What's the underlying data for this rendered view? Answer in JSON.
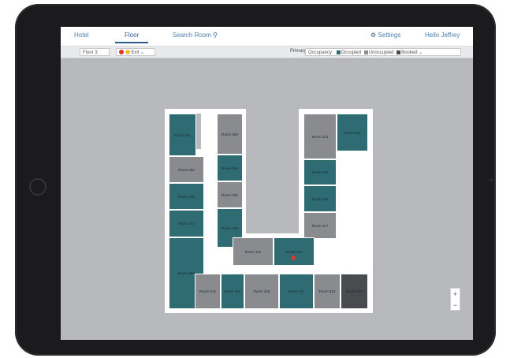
{
  "nav": {
    "tabs": [
      {
        "label": "Hotel"
      },
      {
        "label": "Floor"
      },
      {
        "label": "Search Room"
      }
    ],
    "settings_label": "Settings",
    "user_label": "Hello Jeffrey"
  },
  "toolbar": {
    "floor_select": "Floor 3",
    "status_select": "Exit",
    "filter_label": "Primary",
    "occupancy_select": "Occupancy",
    "legend": [
      {
        "label": "Occupied",
        "color": "#2e6b72"
      },
      {
        "label": "Unoccupied",
        "color": "#8a8b8f"
      },
      {
        "label": "Booked",
        "color": "#4a4b4e"
      }
    ]
  },
  "rooms": [
    {
      "label": "Room 301",
      "status": "teal"
    },
    {
      "label": "Room 302",
      "status": "gray"
    },
    {
      "label": "Room 303",
      "status": "gray"
    },
    {
      "label": "Room 304",
      "status": "teal"
    },
    {
      "label": "Room 305",
      "status": "teal"
    },
    {
      "label": "Room 306",
      "status": "gray"
    },
    {
      "label": "Room 307",
      "status": "teal"
    },
    {
      "label": "Room 308",
      "status": "gray"
    },
    {
      "label": "Room 309",
      "status": "teal"
    },
    {
      "label": "Room 310",
      "status": "teal"
    },
    {
      "label": "Room 311",
      "status": "teal"
    },
    {
      "label": "Room 312",
      "status": "gray"
    },
    {
      "label": "Room 313",
      "status": "teal"
    },
    {
      "label": "Room 314",
      "status": "teal"
    },
    {
      "label": "Room 315",
      "status": "teal"
    },
    {
      "label": "Room 316",
      "status": "gray"
    },
    {
      "label": "Room 317",
      "status": "gray"
    },
    {
      "label": "Room 318",
      "status": "teal"
    },
    {
      "label": "Room 319",
      "status": "gray"
    },
    {
      "label": "Room 320",
      "status": "dark"
    },
    {
      "label": "Room 321",
      "status": "teal"
    },
    {
      "label": "Room 322",
      "status": "gray"
    },
    {
      "label": "Room 323",
      "status": "teal"
    },
    {
      "label": "Room 324",
      "status": "gray"
    }
  ],
  "zoom": {
    "in": "+",
    "out": "−"
  }
}
